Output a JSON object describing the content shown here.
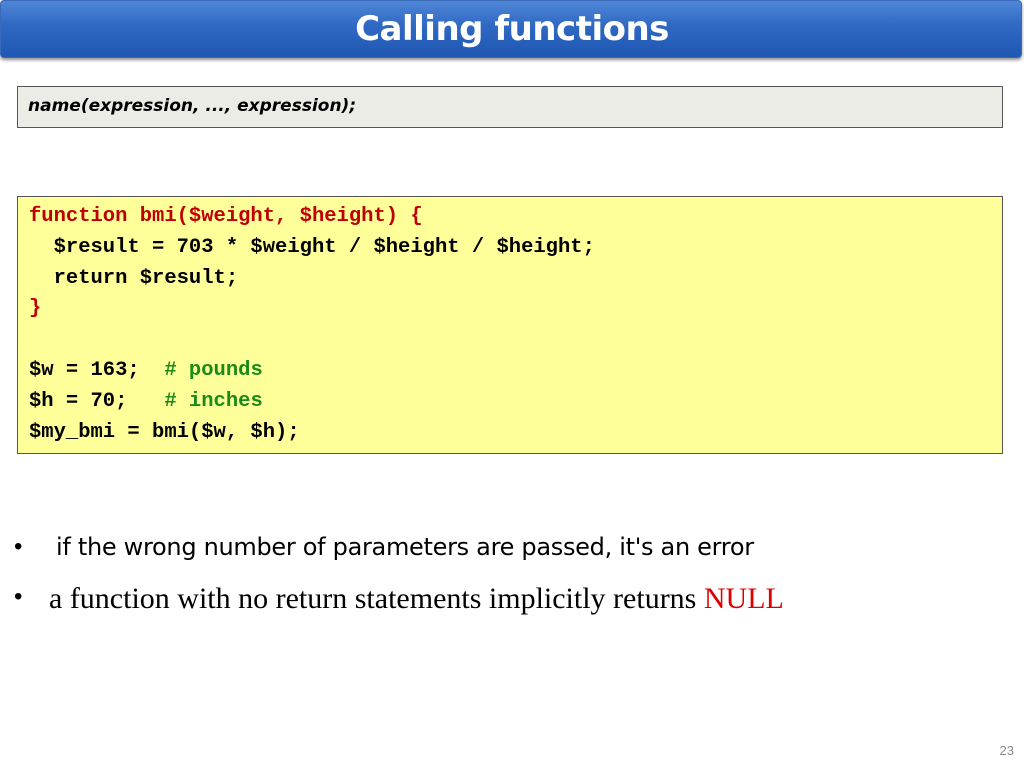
{
  "slide": {
    "title": "Calling functions",
    "syntax": "name(expression, ..., expression);",
    "code": {
      "line1": "function bmi($weight, $height) {",
      "line2": "  $result = 703 * $weight / $height / $height;",
      "line3": "  return $result;",
      "line4": "}",
      "line5": "",
      "line6_code": "$w = 163;  ",
      "line6_comment": "# pounds",
      "line7_code": "$h = 70;   ",
      "line7_comment": "# inches",
      "line8": "$my_bmi = bmi($w, $h);"
    },
    "bullets": [
      {
        "marker": "•",
        "text": "if the wrong number of parameters are passed, it's an error"
      },
      {
        "marker": "•",
        "text": "a function with no return statements implicitly returns ",
        "highlight": "NULL"
      }
    ],
    "page_number": "23",
    "colors": {
      "title_bar": "#2f68c2",
      "code_background": "#ffff99",
      "syntax_background": "#ecece6",
      "keyword_red": "#c00000",
      "comment_green": "#1a8a1a",
      "null_red": "#dd0000"
    }
  }
}
